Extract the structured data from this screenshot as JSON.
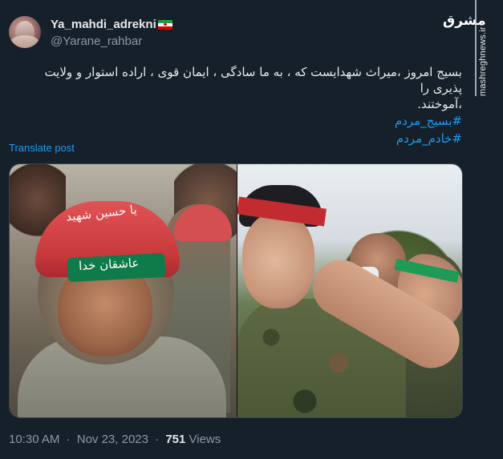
{
  "tweet": {
    "display_name": "Ya_mahdi_adrekni",
    "handle": "@Yarane_rahbar",
    "text_line1": "بسیج امروز  ،میراث شهدایست که ، به ما سادگی ، ایمان قوی ، اراده استوار و ولایت پذیری را",
    "text_line2": "،آموختند.",
    "hashtags": [
      "#بسیج_مردم",
      "#خادم_مردم"
    ],
    "translate_label": "Translate post",
    "time": "10:30 AM",
    "separator": "·",
    "date": "Nov 23, 2023",
    "views_count": "751",
    "views_label": "Views"
  },
  "media": {
    "left_helmet_text": "یا حسین شهید",
    "left_band_text": "عاشقان خدا"
  },
  "watermark": {
    "logo_text": "مشرق",
    "url": "mashreghnews.ir"
  },
  "icons": {
    "flag": "iran-flag-icon"
  },
  "colors": {
    "background": "#15202b",
    "text": "#e7e9ea",
    "secondary": "#8b98a5",
    "link": "#1d9bf0"
  }
}
